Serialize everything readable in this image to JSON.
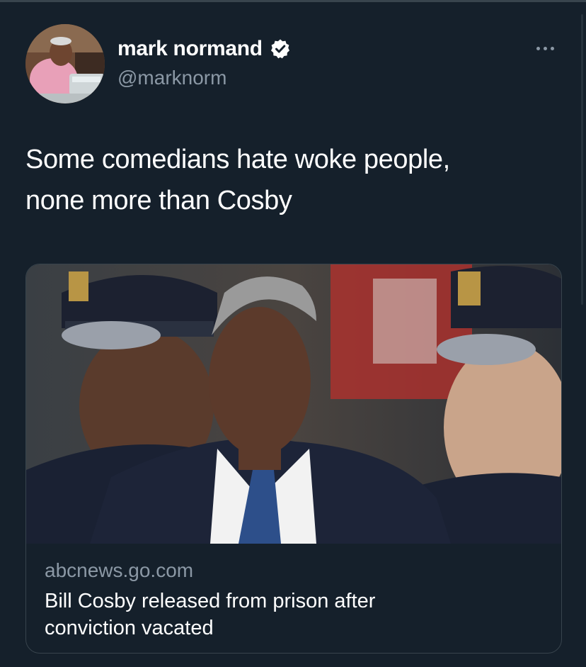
{
  "tweet": {
    "display_name": "mark normand",
    "handle": "@marknorm",
    "text_line_1": "Some comedians hate woke people,",
    "text_line_2": "none more than Cosby",
    "verified": true
  },
  "link_card": {
    "domain": "abcnews.go.com",
    "title_line_1": "Bill Cosby released from prison after",
    "title_line_2": "conviction vacated"
  },
  "icons": {
    "verified": "verified-badge-icon",
    "more": "more-options-icon"
  },
  "colors": {
    "background": "#15202b",
    "text_primary": "#ffffff",
    "text_secondary": "#8b98a5",
    "border": "#38444d"
  }
}
